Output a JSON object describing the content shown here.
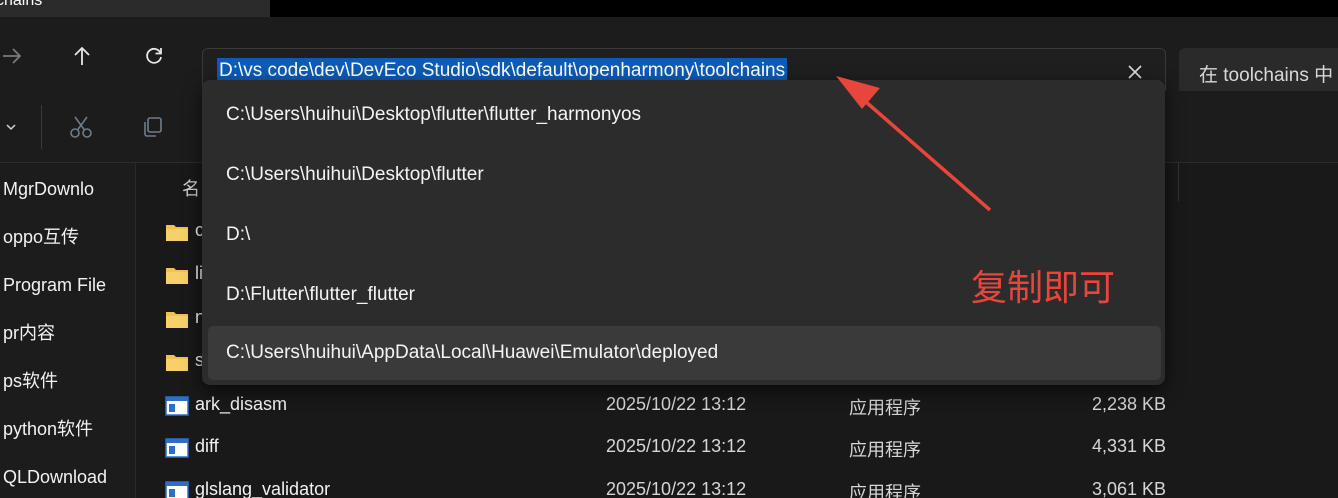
{
  "window": {
    "tab_title": "chains",
    "tab_fragment": "'"
  },
  "address": {
    "path": "D:\\vs code\\dev\\DevEco Studio\\sdk\\default\\openharmony\\toolchains",
    "search_placeholder": "在 toolchains 中"
  },
  "dropdown": {
    "items": [
      {
        "label": "C:\\Users\\huihui\\Desktop\\flutter\\flutter_harmonyos"
      },
      {
        "label": "C:\\Users\\huihui\\Desktop\\flutter"
      },
      {
        "label": "D:\\"
      },
      {
        "label": "D:\\Flutter\\flutter_flutter"
      },
      {
        "label": "C:\\Users\\huihui\\AppData\\Local\\Huawei\\Emulator\\deployed"
      }
    ]
  },
  "sidebar": {
    "items": [
      {
        "label": "MgrDownlo"
      },
      {
        "label": "oppo互传"
      },
      {
        "label": "Program File"
      },
      {
        "label": "pr内容"
      },
      {
        "label": "ps软件"
      },
      {
        "label": "python软件"
      },
      {
        "label": "QLDownload"
      }
    ]
  },
  "filelist": {
    "name_header": "名",
    "folders": [
      {
        "name": "c"
      },
      {
        "name": "li"
      },
      {
        "name": "n"
      },
      {
        "name": "s"
      }
    ],
    "files": [
      {
        "name": "ark_disasm",
        "date": "2025/10/22 13:12",
        "type": "应用程序",
        "size": "2,238 KB"
      },
      {
        "name": "diff",
        "date": "2025/10/22 13:12",
        "type": "应用程序",
        "size": "4,331 KB"
      },
      {
        "name": "glslang_validator",
        "date": "2025/10/22 13:12",
        "type": "应用程序",
        "size": "3,061 KB"
      }
    ]
  },
  "annotation": {
    "text": "复制即可",
    "color": "#e8453c"
  },
  "colors": {
    "accent": "#4fa8f0",
    "selection": "#0c5bb8",
    "folder": "#f2c14e"
  }
}
